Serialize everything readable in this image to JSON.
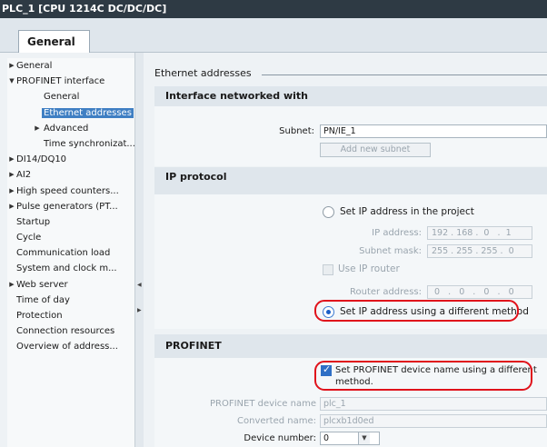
{
  "window": {
    "title": "PLC_1 [CPU 1214C DC/DC/DC]"
  },
  "tabs": {
    "general": "General"
  },
  "tree": {
    "items": [
      {
        "label": "General",
        "level": 0,
        "arrow": "right"
      },
      {
        "label": "PROFINET interface",
        "level": 0,
        "arrow": "down"
      },
      {
        "label": "General",
        "level": 1,
        "arrow": ""
      },
      {
        "label": "Ethernet addresses",
        "level": 1,
        "arrow": "",
        "selected": true
      },
      {
        "label": "Advanced",
        "level": 1,
        "arrow": "right"
      },
      {
        "label": "Time synchronizat...",
        "level": 1,
        "arrow": ""
      },
      {
        "label": "DI14/DQ10",
        "level": 0,
        "arrow": "right"
      },
      {
        "label": "AI2",
        "level": 0,
        "arrow": "right"
      },
      {
        "label": "High speed counters...",
        "level": 0,
        "arrow": "right"
      },
      {
        "label": "Pulse generators (PT...",
        "level": 0,
        "arrow": "right"
      },
      {
        "label": "Startup",
        "level": 0,
        "arrow": ""
      },
      {
        "label": "Cycle",
        "level": 0,
        "arrow": ""
      },
      {
        "label": "Communication load",
        "level": 0,
        "arrow": ""
      },
      {
        "label": "System and clock m...",
        "level": 0,
        "arrow": ""
      },
      {
        "label": "Web server",
        "level": 0,
        "arrow": "right"
      },
      {
        "label": "Time of day",
        "level": 0,
        "arrow": ""
      },
      {
        "label": "Protection",
        "level": 0,
        "arrow": ""
      },
      {
        "label": "Connection resources",
        "level": 0,
        "arrow": ""
      },
      {
        "label": "Overview of address...",
        "level": 0,
        "arrow": ""
      }
    ]
  },
  "content": {
    "section_title": "Ethernet addresses",
    "interface": {
      "heading": "Interface networked with",
      "subnet_label": "Subnet:",
      "subnet_value": "PN/IE_1",
      "add_subnet_button": "Add new subnet"
    },
    "ip": {
      "heading": "IP protocol",
      "set_in_project": "Set IP address in the project",
      "ip_address_label": "IP address:",
      "ip_address_value": "192 . 168 .  0   .  1",
      "subnet_mask_label": "Subnet mask:",
      "subnet_mask_value": "255 . 255 . 255 .  0",
      "use_router": "Use IP router",
      "router_address_label": "Router address:",
      "router_address_value": " 0   .   0   .   0   .   0",
      "different_method": "Set IP address using a different method"
    },
    "profinet": {
      "heading": "PROFINET",
      "device_name_option_line1": "Set PROFINET device name using a different",
      "device_name_option_line2": "method.",
      "device_name_label": "PROFINET device name",
      "device_name_value": "plc_1",
      "converted_name_label": "Converted name:",
      "converted_name_value": "plcxb1d0ed",
      "device_number_label": "Device number:",
      "device_number_value": "0"
    }
  },
  "colors": {
    "title_bar": "#2e3a44",
    "selection": "#3f7fc3",
    "highlight_ring": "#e0121b"
  }
}
